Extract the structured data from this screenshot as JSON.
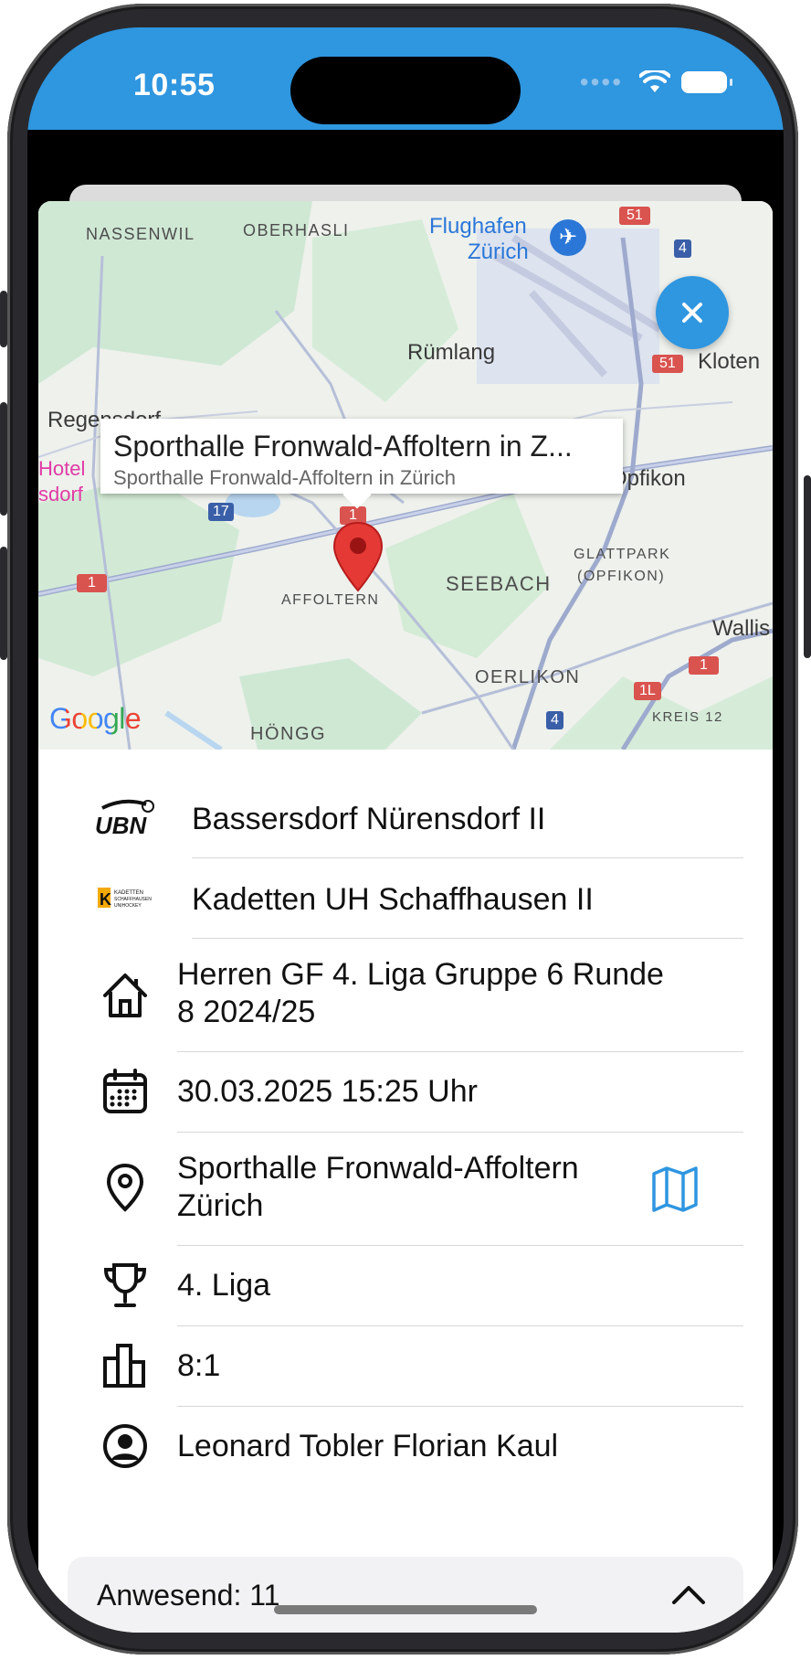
{
  "status_bar": {
    "time": "10:55",
    "background": "#2f96e0"
  },
  "map": {
    "labels": {
      "nassenwil": "NASSENWIL",
      "oberhasli": "OBERHASLI",
      "flughafen_line1": "Flughafen",
      "flughafen_line2": "Zürich",
      "ruemlang": "Rümlang",
      "kloten": "Kloten",
      "regensdorf": "Regensdorf",
      "hotel": "Hotel",
      "sdorf": "sdorf",
      "opfikon": "Opfikon",
      "glattpark_line1": "GLATTPARK",
      "glattpark_line2": "(OPFIKON)",
      "seebach": "SEEBACH",
      "affoltern": "AFFOLTERN",
      "wallis": "Wallis",
      "oerlikon": "OERLIKON",
      "kreis12": "KREIS 12",
      "hoengg": "HÖNGG"
    },
    "road_shields": [
      "51",
      "4",
      "51",
      "17",
      "1",
      "1",
      "1",
      "1L",
      "4"
    ],
    "callout": {
      "title": "Sporthalle Fronwald-Affoltern in Z...",
      "subtitle": "Sporthalle Fronwald-Affoltern in Zürich"
    },
    "attribution": "Google",
    "close_icon": "close-icon"
  },
  "details": {
    "home_team": "Bassersdorf Nürensdorf II",
    "away_team": "Kadetten UH Schaffhausen II",
    "competition": "Herren GF 4. Liga Gruppe 6 Runde 8 2024/25",
    "datetime": "30.03.2025 15:25 Uhr",
    "venue": "Sporthalle Fronwald-Affoltern Zürich",
    "league": "4. Liga",
    "score": "8:1",
    "referees": "Leonard Tobler Florian Kaul"
  },
  "home_logo_text": "UBN",
  "away_logo_text": "KADETTEN SCHAFFHAUSEN UNIHOCKEY",
  "attendance": {
    "label": "Anwesend: 11"
  },
  "colors": {
    "accent": "#2f96e0",
    "pin": "#e53935"
  }
}
